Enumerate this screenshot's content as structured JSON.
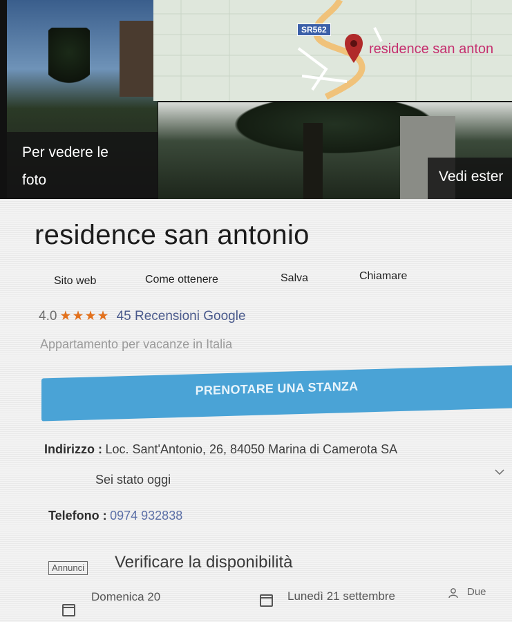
{
  "photos": {
    "left_overlay_line1": "Per vedere le",
    "left_overlay_line2": "foto",
    "right_overlay": "Vedi ester"
  },
  "map": {
    "road_badge": "SR562",
    "pin_label": "residence san anton",
    "pin_icon": "map-pin-icon",
    "pin_color": "#c5306f"
  },
  "place": {
    "title": "residence san antonio",
    "rating_value": "4.0",
    "stars": "★★★★",
    "rating_stars_shown": 4,
    "rating_max": 5,
    "reviews_link": "45 Recensioni Google",
    "category": "Appartamento per vacanze in Italia"
  },
  "actions": [
    {
      "label": "Sito web"
    },
    {
      "label": "Come ottenere"
    },
    {
      "label": "Salva"
    },
    {
      "label": "Chiamare"
    }
  ],
  "booking": {
    "button_label": "PRENOTARE UNA STANZA",
    "button_color": "#4aa3d6"
  },
  "details": {
    "address_label": "Indirizzo :",
    "address_value": "Loc. Sant'Antonio, 26, 84050 Marina di Camerota SA",
    "visited_text": "Sei stato oggi",
    "phone_label": "Telefono :",
    "phone_value": "0974 932838"
  },
  "availability": {
    "ad_badge": "Annunci",
    "heading": "Verificare la disponibilità",
    "checkin": "Domenica 20",
    "checkout": "Lunedì 21 settembre",
    "guests": "Due"
  },
  "colors": {
    "accent_star": "#e2711d",
    "link_blue": "#4a5a8c"
  }
}
